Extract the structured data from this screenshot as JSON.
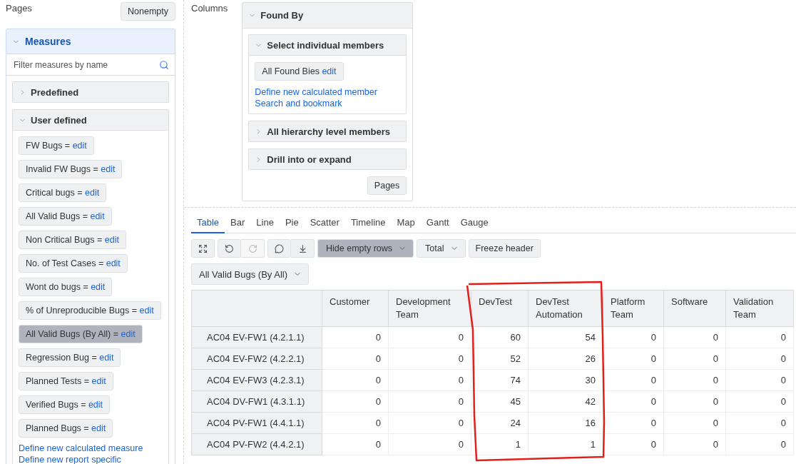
{
  "pages": {
    "title": "Pages",
    "button": "Nonempty"
  },
  "measures": {
    "title": "Measures",
    "expanded": true,
    "filter_placeholder": "Filter measures by name",
    "sections": [
      {
        "title": "Predefined",
        "expanded": false
      },
      {
        "title": "User defined",
        "expanded": true,
        "items": [
          {
            "label": "FW Bugs =",
            "edit": "edit",
            "selected": false
          },
          {
            "label": "Invalid FW Bugs =",
            "edit": "edit",
            "selected": false
          },
          {
            "label": "Critical bugs =",
            "edit": "edit",
            "selected": false
          },
          {
            "label": "All Valid Bugs =",
            "edit": "edit",
            "selected": false
          },
          {
            "label": "Non Critical Bugs =",
            "edit": "edit",
            "selected": false
          },
          {
            "label": "No. of Test Cases =",
            "edit": "edit",
            "selected": false
          },
          {
            "label": "Wont do bugs =",
            "edit": "edit",
            "selected": false
          },
          {
            "label": "% of Unreproducible Bugs =",
            "edit": "edit",
            "selected": false
          },
          {
            "label": "All Valid Bugs (By All) =",
            "edit": "edit",
            "selected": true
          },
          {
            "label": "Regression Bug =",
            "edit": "edit",
            "selected": false
          },
          {
            "label": "Planned Tests =",
            "edit": "edit",
            "selected": false
          },
          {
            "label": "Verified Bugs =",
            "edit": "edit",
            "selected": false
          },
          {
            "label": "Planned Bugs =",
            "edit": "edit",
            "selected": false
          }
        ],
        "links": [
          "Define new calculated measure",
          "Define new report specific"
        ]
      }
    ]
  },
  "columns": {
    "label": "Columns",
    "dimension": {
      "title": "Found By",
      "expanded": true,
      "sections": [
        {
          "title": "Select individual members",
          "expanded": true,
          "members": [
            {
              "label": "All Found Bies",
              "edit": "edit"
            }
          ],
          "links": [
            "Define new calculated member",
            "Search and bookmark"
          ]
        },
        {
          "title": "All hierarchy level members",
          "expanded": false
        },
        {
          "title": "Drill into or expand",
          "expanded": false
        }
      ],
      "button": "Pages"
    }
  },
  "view_tabs": [
    {
      "label": "Table",
      "selected": true
    },
    {
      "label": "Bar",
      "selected": false
    },
    {
      "label": "Line",
      "selected": false
    },
    {
      "label": "Pie",
      "selected": false
    },
    {
      "label": "Scatter",
      "selected": false
    },
    {
      "label": "Timeline",
      "selected": false
    },
    {
      "label": "Map",
      "selected": false
    },
    {
      "label": "Gantt",
      "selected": false
    },
    {
      "label": "Gauge",
      "selected": false
    }
  ],
  "toolbar": {
    "icon_buttons": [
      {
        "disabled": false
      },
      {
        "disabled": false
      },
      {
        "disabled": true
      },
      {
        "disabled": false
      },
      {
        "disabled": false
      }
    ],
    "dropdowns": [
      {
        "label": "Hide empty rows",
        "active": true
      },
      {
        "label": "Total",
        "active": false
      }
    ],
    "button": "Freeze header"
  },
  "measure_select": "All Valid Bugs (By All)",
  "table": {
    "columns": [
      "Customer",
      "Development Team",
      "DevTest",
      "DevTest Automation",
      "Platform Team",
      "Software",
      "Validation Team"
    ],
    "rows": [
      {
        "label": "AC04 EV-FW1 (4.2.1.1)",
        "values": [
          "0",
          "0",
          "60",
          "54",
          "0",
          "0",
          "0"
        ]
      },
      {
        "label": "AC04 EV-FW2 (4.2.2.1)",
        "values": [
          "0",
          "0",
          "52",
          "26",
          "0",
          "0",
          "0"
        ]
      },
      {
        "label": "AC04 EV-FW3 (4.2.3.1)",
        "values": [
          "0",
          "0",
          "74",
          "30",
          "0",
          "0",
          "0"
        ]
      },
      {
        "label": "AC04 DV-FW1 (4.3.1.1)",
        "values": [
          "0",
          "0",
          "45",
          "42",
          "0",
          "0",
          "0"
        ]
      },
      {
        "label": "AC04 PV-FW1 (4.4.1.1)",
        "values": [
          "0",
          "0",
          "24",
          "16",
          "0",
          "0",
          "0"
        ]
      },
      {
        "label": "AC04 PV-FW2 (4.4.2.1)",
        "values": [
          "0",
          "0",
          "1",
          "1",
          "0",
          "0",
          "0"
        ]
      }
    ]
  }
}
